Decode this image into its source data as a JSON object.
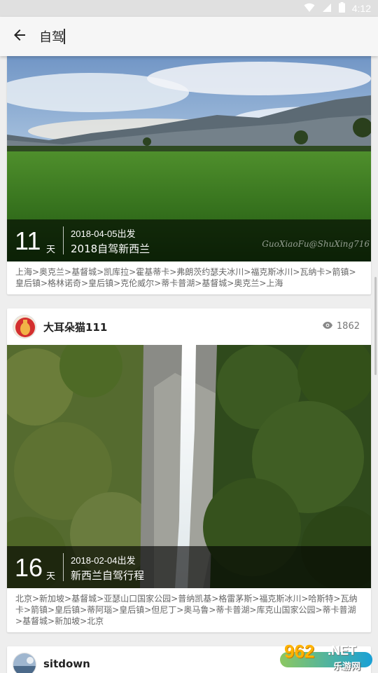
{
  "status_bar": {
    "time": "4:12",
    "icons": [
      "wifi-icon",
      "signal-icon",
      "battery-icon"
    ]
  },
  "search": {
    "query": "自驾",
    "back_icon": "arrow-left-icon"
  },
  "posts": [
    {
      "days": "11",
      "days_unit": "天",
      "date": "2018-04-05出发",
      "title": "2018自驾新西兰",
      "watermark": "GuoXiaoFu@ShuXing716",
      "route": "上海>奥克兰>基督城>凯库拉>霍基蒂卡>弗朗茨约瑟夫冰川>福克斯冰川>瓦纳卡>箭镇>皇后镇>格林诺奇>皇后镇>克伦威尔>蒂卡普湖>基督城>奥克兰>上海"
    },
    {
      "author": "大耳朵猫111",
      "views": "1862",
      "days": "16",
      "days_unit": "天",
      "date": "2018-02-04出发",
      "title": "新西兰自驾行程",
      "route": "北京>新加坡>基督城>亚瑟山口国家公园>普纳凯基>格雷茅斯>福克斯冰川>哈斯特>瓦纳卡>箭镇>皇后镇>蒂阿瑙>皇后镇>但尼丁>奥马鲁>蒂卡普湖>库克山国家公园>蒂卡普湖>基督城>新加坡>北京"
    },
    {
      "author": "sitdown"
    }
  ],
  "watermark_badge": {
    "brand": "962",
    "tld": ".NET",
    "site_name": "乐游网"
  },
  "colors": {
    "overlay": "#000000",
    "badge_orange": "#ffb300",
    "badge_blue": "#0096d2"
  }
}
